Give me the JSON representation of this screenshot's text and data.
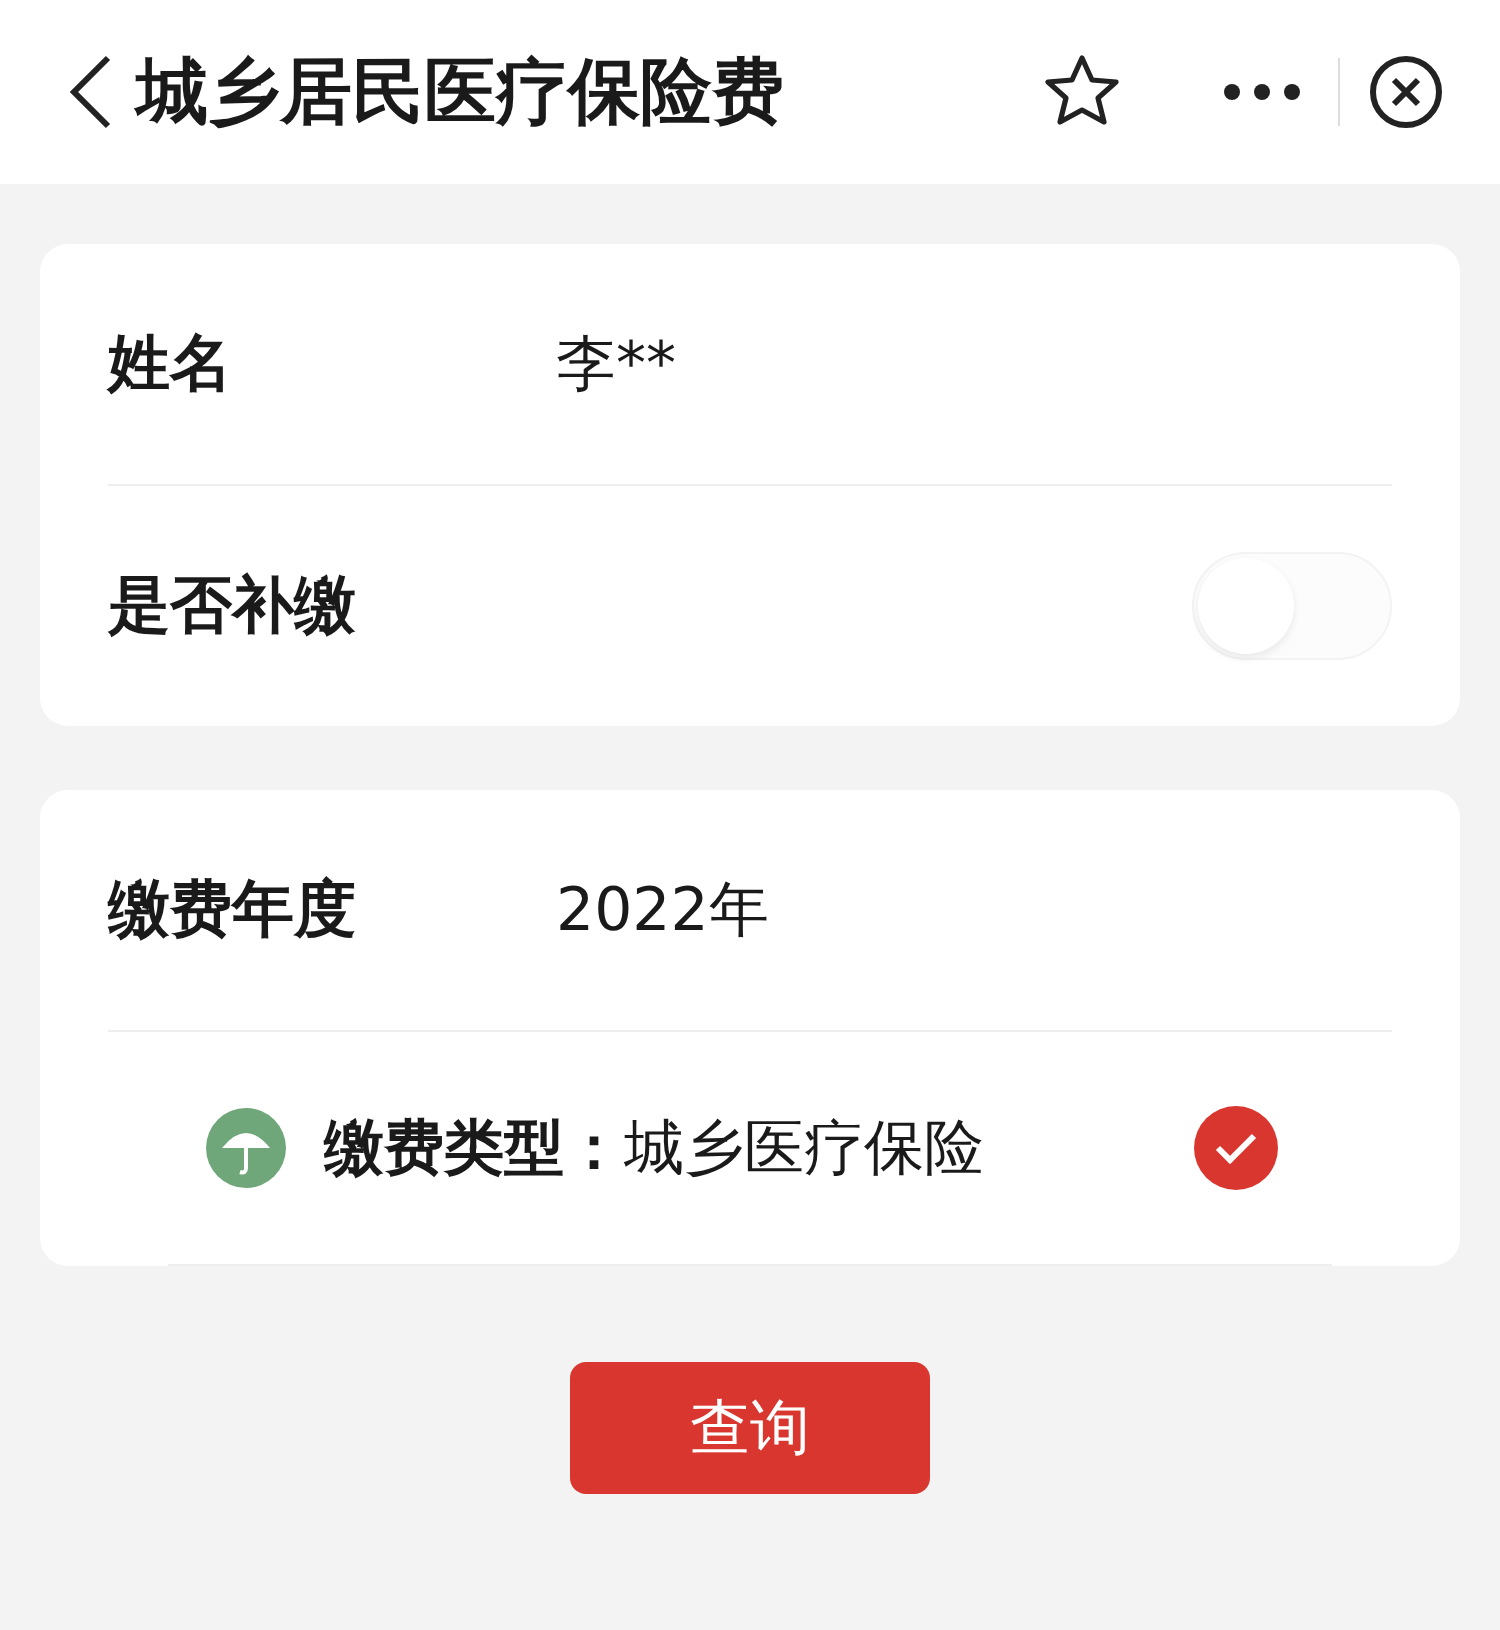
{
  "header": {
    "title": "城乡居民医疗保险费"
  },
  "personal": {
    "name_label": "姓名",
    "name_value": "李**",
    "backpay_label": "是否补缴",
    "backpay_on": false
  },
  "payment": {
    "year_label": "缴费年度",
    "year_value": "2022年",
    "type_text": "**缴费类型：**城乡医疗保险",
    "type_checked": true
  },
  "query_button": "查询"
}
